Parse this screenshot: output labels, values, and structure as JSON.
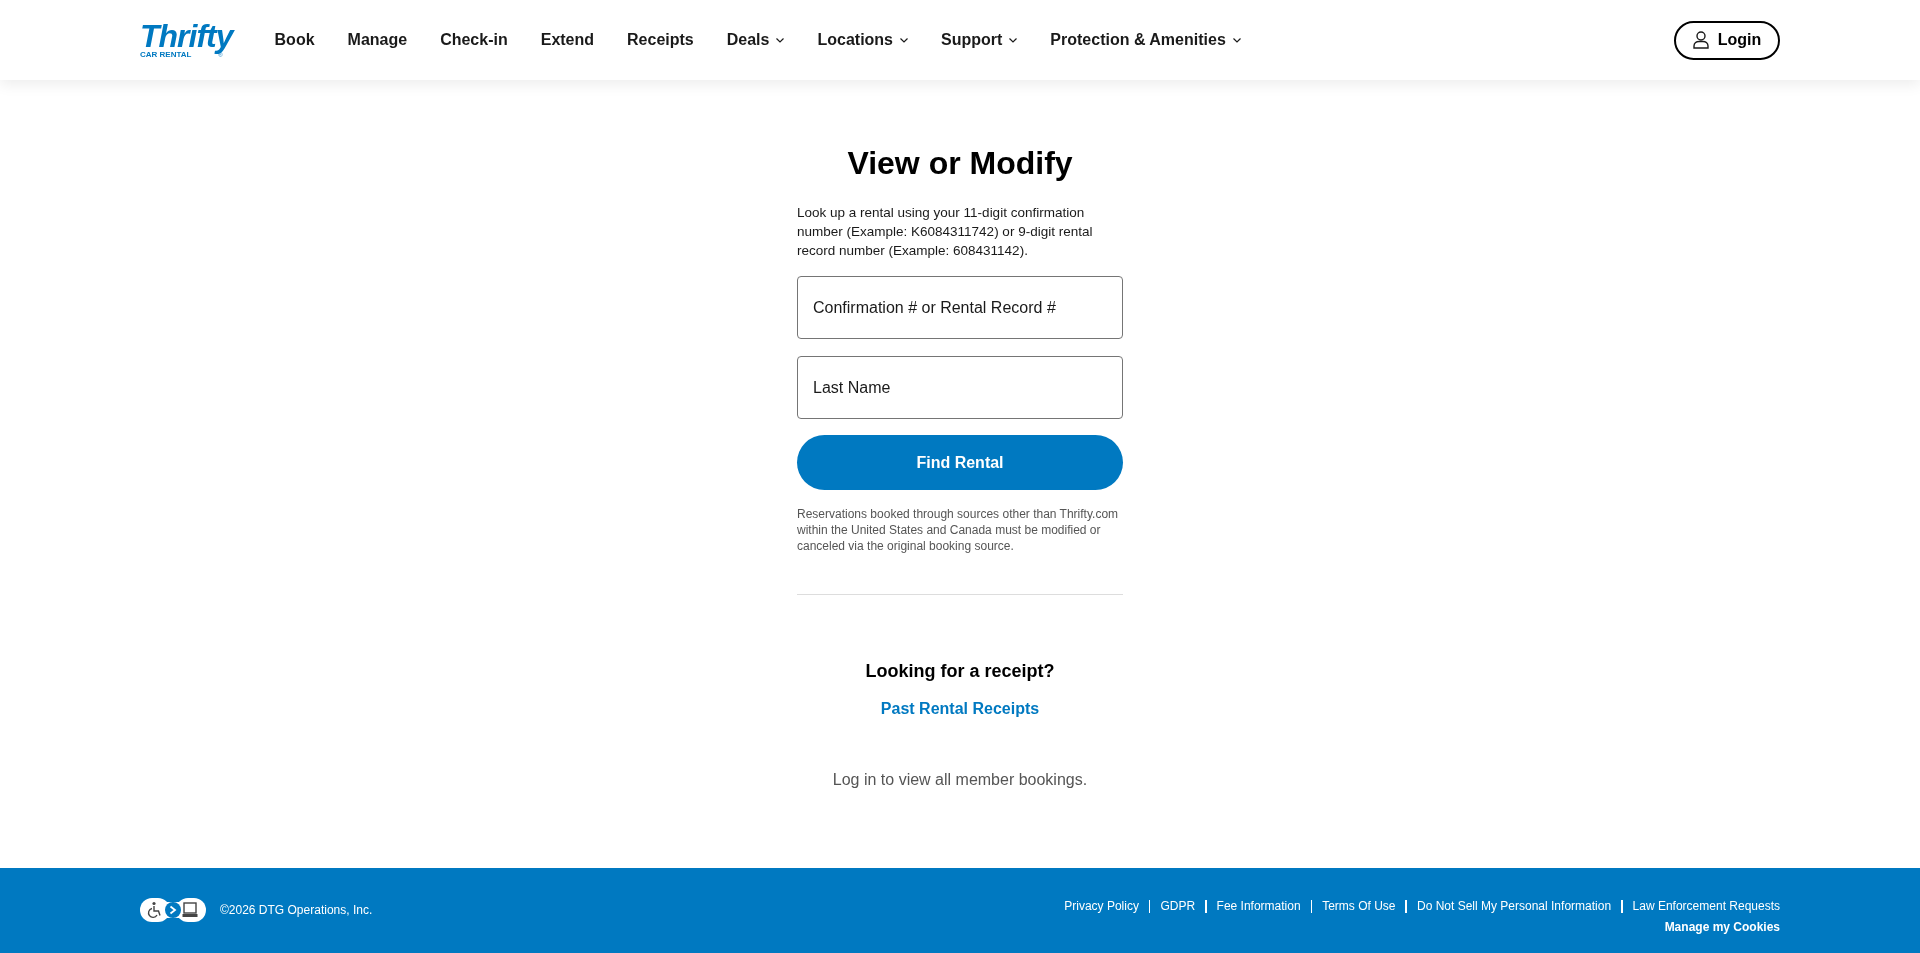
{
  "header": {
    "logo": {
      "wordmark": "Thrifty",
      "tagline": "CAR RENTAL",
      "mark": "®"
    },
    "nav": [
      {
        "label": "Book",
        "kind": "link"
      },
      {
        "label": "Manage",
        "kind": "link"
      },
      {
        "label": "Check-in",
        "kind": "link"
      },
      {
        "label": "Extend",
        "kind": "link"
      },
      {
        "label": "Receipts",
        "kind": "link"
      },
      {
        "label": "Deals",
        "kind": "dropdown"
      },
      {
        "label": "Locations",
        "kind": "dropdown"
      },
      {
        "label": "Support",
        "kind": "dropdown"
      },
      {
        "label": "Protection & Amenities",
        "kind": "dropdown"
      }
    ],
    "login": {
      "label": "Login"
    }
  },
  "lookup": {
    "title": "View or Modify",
    "description": "Look up a rental using your 11-digit confirmation number (Example: K6084311742) or 9-digit rental record number (Example: 608431142).",
    "fields": [
      {
        "placeholder": "Confirmation # or Rental Record #"
      },
      {
        "placeholder": "Last Name"
      }
    ],
    "submit": "Find Rental",
    "note": "Reservations booked through sources other than Thrifty.com within the United States and Canada must be modified or canceled via the original booking source."
  },
  "receipts": {
    "heading": "Looking for a receipt?",
    "link": "Past Rental Receipts"
  },
  "member_note": "Log in to view all member bookings.",
  "footer": {
    "copyright": "©2026 DTG Operations, Inc.",
    "links": [
      "Privacy Policy",
      "GDPR",
      "Fee Information",
      "Terms Of Use",
      "Do Not Sell My Personal Information",
      "Law Enforcement Requests"
    ],
    "cookies": "Manage my Cookies"
  }
}
